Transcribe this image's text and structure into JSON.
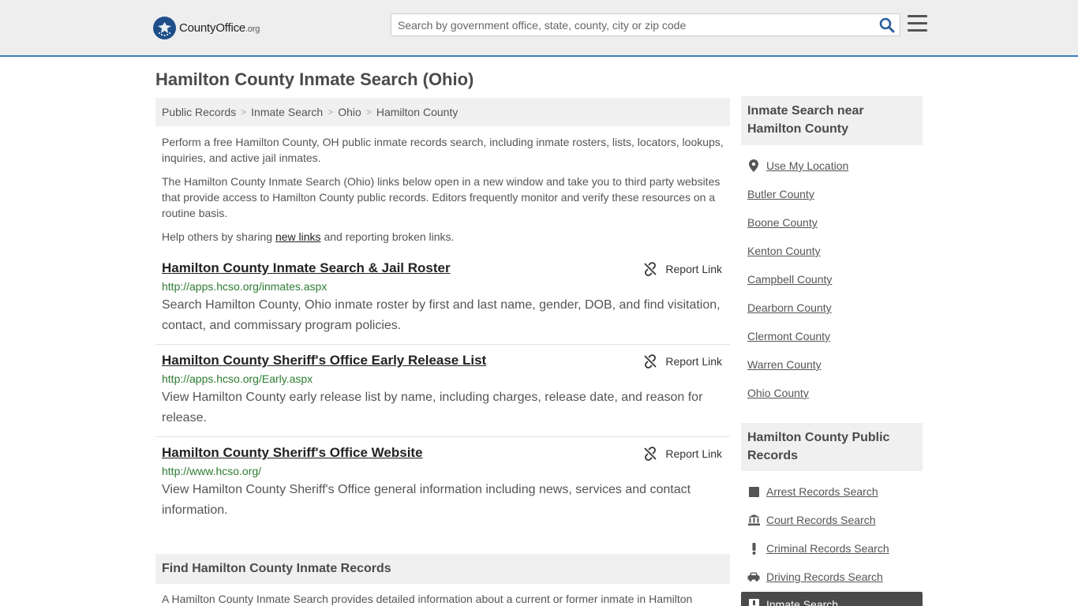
{
  "header": {
    "logo_text_main": "CountyOffice",
    "logo_text_org": ".org",
    "search_placeholder": "Search by government office, state, county, city or zip code"
  },
  "page_title": "Hamilton County Inmate Search (Ohio)",
  "breadcrumb": [
    "Public Records",
    "Inmate Search",
    "Ohio",
    "Hamilton County"
  ],
  "intro": {
    "p1": "Perform a free Hamilton County, OH public inmate records search, including inmate rosters, lists, locators, lookups, inquiries, and active jail inmates.",
    "p2": "The Hamilton County Inmate Search (Ohio) links below open in a new window and take you to third party websites that provide access to Hamilton County public records. Editors frequently monitor and verify these resources on a routine basis.",
    "p3_before": "Help others by sharing ",
    "p3_link": "new links",
    "p3_after": " and reporting broken links."
  },
  "report_link_label": "Report Link",
  "results": [
    {
      "title": "Hamilton County Inmate Search & Jail Roster",
      "url": "http://apps.hcso.org/inmates.aspx",
      "description": "Search Hamilton County, Ohio inmate roster by first and last name, gender, DOB, and find visitation, contact, and commissary program policies."
    },
    {
      "title": "Hamilton County Sheriff's Office Early Release List",
      "url": "http://apps.hcso.org/Early.aspx",
      "description": "View Hamilton County early release list by name, including charges, release date, and reason for release."
    },
    {
      "title": "Hamilton County Sheriff's Office Website",
      "url": "http://www.hcso.org/",
      "description": "View Hamilton County Sheriff's Office general information including news, services and contact information."
    }
  ],
  "find_section": {
    "heading": "Find Hamilton County Inmate Records",
    "text": "A Hamilton County Inmate Search provides detailed information about a current or former inmate in Hamilton"
  },
  "sidebar": {
    "near_heading": "Inmate Search near Hamilton County",
    "use_location": "Use My Location",
    "near_links": [
      "Butler County",
      "Boone County",
      "Kenton County",
      "Campbell County",
      "Dearborn County",
      "Clermont County",
      "Warren County",
      "Ohio County"
    ],
    "records_heading": "Hamilton County Public Records",
    "records_links": [
      {
        "label": "Arrest Records Search",
        "icon": "square-icon"
      },
      {
        "label": "Court Records Search",
        "icon": "courthouse-icon"
      },
      {
        "label": "Criminal Records Search",
        "icon": "exclamation-icon"
      },
      {
        "label": "Driving Records Search",
        "icon": "car-icon"
      }
    ],
    "active_link": "Inmate Search"
  },
  "colors": {
    "header_bg": "#eeeeee",
    "accent_blue": "#3f7dbf",
    "url_green": "#2e7d32",
    "panel_gray": "#f0f0f0",
    "active_bg": "#4a4a4a"
  }
}
